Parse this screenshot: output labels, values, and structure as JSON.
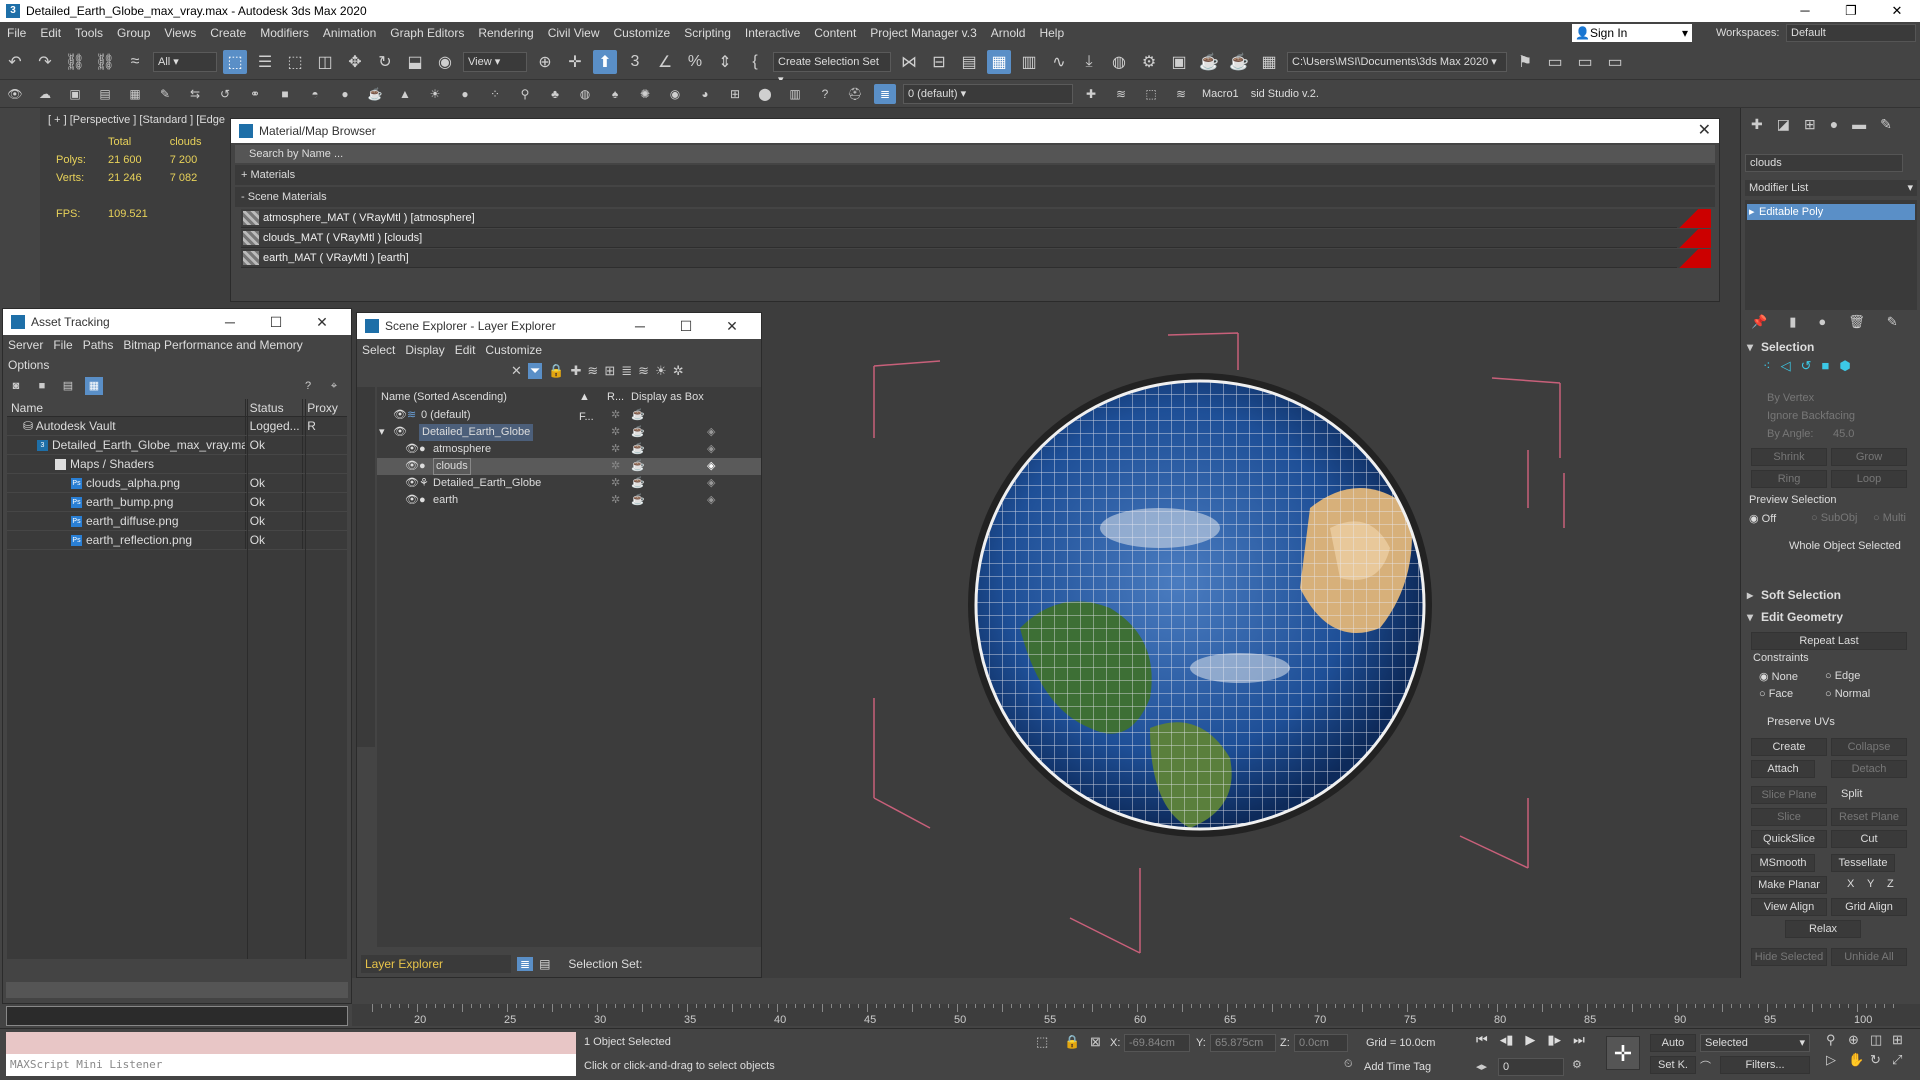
{
  "window": {
    "title": "Detailed_Earth_Globe_max_vray.max - Autodesk 3ds Max 2020"
  },
  "menu": [
    "File",
    "Edit",
    "Tools",
    "Group",
    "Views",
    "Create",
    "Modifiers",
    "Animation",
    "Graph Editors",
    "Rendering",
    "Civil View",
    "Customize",
    "Scripting",
    "Interactive",
    "Content",
    "Project Manager v.3",
    "Arnold",
    "Help"
  ],
  "account": {
    "sign_in": "Sign In",
    "workspaces_label": "Workspaces:",
    "workspace": "Default"
  },
  "toolbar": {
    "filter": "All",
    "ref_coord": "View",
    "selection_set": "Create Selection Set",
    "project_path": "C:\\Users\\MSI\\Documents\\3ds Max 2020",
    "layer": "0 (default)",
    "macro1": "Macro1",
    "studio": "sid Studio v.2."
  },
  "viewport": {
    "label": "[ + ] [Perspective ]  [Standard ]  [Edge",
    "stats": {
      "total_label": "Total",
      "object_label": "clouds",
      "polys_label": "Polys:",
      "polys_total": "21 600",
      "polys_obj": "7 200",
      "verts_label": "Verts:",
      "verts_total": "21 246",
      "verts_obj": "7 082",
      "fps_label": "FPS:",
      "fps": "109.521"
    }
  },
  "material_browser": {
    "title": "Material/Map Browser",
    "search_placeholder": "Search by Name ...",
    "materials": "+ Materials",
    "scene_materials": "- Scene Materials",
    "items": [
      {
        "label": "atmosphere_MAT  ( VRayMtl )  [atmosphere]"
      },
      {
        "label": "clouds_MAT  ( VRayMtl )  [clouds]"
      },
      {
        "label": "earth_MAT  ( VRayMtl )  [earth]"
      }
    ]
  },
  "asset_tracking": {
    "title": "Asset Tracking",
    "menu": [
      "Server",
      "File",
      "Paths",
      "Bitmap Performance and Memory"
    ],
    "options": "Options",
    "columns": [
      "Name",
      "Status",
      "Proxy R"
    ],
    "rows": [
      {
        "name": "Autodesk Vault",
        "status": "Logged...",
        "indent": 0
      },
      {
        "name": "Detailed_Earth_Globe_max_vray.max",
        "status": "Ok",
        "indent": 1
      },
      {
        "name": "Maps / Shaders",
        "status": "",
        "indent": 2
      },
      {
        "name": "clouds_alpha.png",
        "status": "Ok",
        "indent": 3
      },
      {
        "name": "earth_bump.png",
        "status": "Ok",
        "indent": 3
      },
      {
        "name": "earth_diffuse.png",
        "status": "Ok",
        "indent": 3
      },
      {
        "name": "earth_reflection.png",
        "status": "Ok",
        "indent": 3
      }
    ]
  },
  "scene_explorer": {
    "title": "Scene Explorer - Layer Explorer",
    "menu": [
      "Select",
      "Display",
      "Edit",
      "Customize"
    ],
    "col_name": "Name (Sorted Ascending)",
    "col_f": "▲ F...",
    "col_r": "R...",
    "col_display": "Display as Box",
    "rows": [
      {
        "name": "0 (default)",
        "level": 0
      },
      {
        "name": "Detailed_Earth_Globe",
        "level": 0
      },
      {
        "name": "atmosphere",
        "level": 1
      },
      {
        "name": "clouds",
        "level": 1
      },
      {
        "name": "Detailed_Earth_Globe",
        "level": 1
      },
      {
        "name": "earth",
        "level": 1
      }
    ],
    "footer_mode": "Layer Explorer",
    "selection_set_label": "Selection Set:"
  },
  "command_panel": {
    "object_name": "clouds",
    "modifier_list": "Modifier List",
    "stack_item": "Editable Poly",
    "selection": {
      "title": "Selection",
      "by_vertex": "By Vertex",
      "ignore_backfacing": "Ignore Backfacing",
      "by_angle": "By Angle:",
      "angle": "45.0",
      "shrink": "Shrink",
      "grow": "Grow",
      "ring": "Ring",
      "loop": "Loop",
      "preview_selection": "Preview Selection",
      "off": "Off",
      "subobj": "SubObj",
      "multi": "Multi",
      "whole_object": "Whole Object Selected"
    },
    "soft_selection": "Soft Selection",
    "edit_geometry": {
      "title": "Edit Geometry",
      "repeat_last": "Repeat Last",
      "constraints": "Constraints",
      "none": "None",
      "edge": "Edge",
      "face": "Face",
      "normal": "Normal",
      "preserve_uvs": "Preserve UVs",
      "create": "Create",
      "collapse": "Collapse",
      "attach": "Attach",
      "detach": "Detach",
      "slice_plane": "Slice Plane",
      "split": "Split",
      "slice": "Slice",
      "reset_plane": "Reset Plane",
      "quickslice": "QuickSlice",
      "cut": "Cut",
      "msmooth": "MSmooth",
      "tessellate": "Tessellate",
      "make_planar": "Make Planar",
      "x": "X",
      "y": "Y",
      "z": "Z",
      "view_align": "View Align",
      "grid_align": "Grid Align",
      "relax": "Relax",
      "hide_selected": "Hide Selected",
      "unhide_all": "Unhide All"
    }
  },
  "timeline": {
    "ticks": [
      "20",
      "25",
      "30",
      "35",
      "40",
      "45",
      "50",
      "55",
      "60",
      "65",
      "70",
      "75",
      "80",
      "85",
      "90",
      "95",
      "100"
    ]
  },
  "status": {
    "maxscript": "MAXScript Mini Listener",
    "selected": "1 Object Selected",
    "prompt": "Click or click-and-drag to select objects",
    "x_label": "X:",
    "x_value": "-69.84cm",
    "y_label": "Y:",
    "y_value": "65.875cm",
    "z_label": "Z:",
    "z_value": "0.0cm",
    "grid": "Grid = 10.0cm",
    "add_time_tag": "Add Time Tag",
    "auto": "Auto",
    "set_k": "Set K.",
    "key_mode": "Selected",
    "filters": "Filters...",
    "frame": "0"
  },
  "colors": {
    "accent": "#5a8fc7",
    "bbox": "#c8607a",
    "stats": "#e8d25a"
  }
}
